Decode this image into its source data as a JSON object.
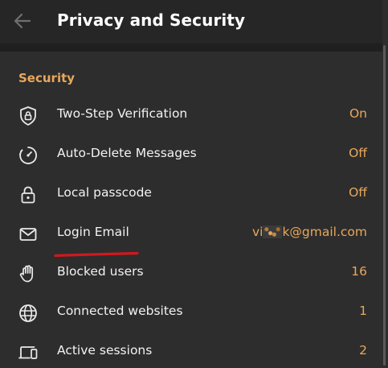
{
  "header": {
    "title": "Privacy and Security",
    "back_icon": "arrow-left-icon"
  },
  "colors": {
    "accent": "#e8a85b",
    "background": "#2d2d2d",
    "header_bg": "#262626",
    "text": "#f2f2f2",
    "annotation": "#d0191d"
  },
  "security": {
    "section_title": "Security",
    "items": [
      {
        "label": "Two-Step Verification",
        "value": "On",
        "icon": "shield-lock-icon"
      },
      {
        "label": "Auto-Delete Messages",
        "value": "Off",
        "icon": "timer-icon"
      },
      {
        "label": "Local passcode",
        "value": "Off",
        "icon": "padlock-icon"
      },
      {
        "label": "Login Email",
        "value_prefix": "vi",
        "value_suffix": "k@gmail.com",
        "icon": "envelope-icon"
      },
      {
        "label": "Blocked users",
        "value": "16",
        "icon": "hand-icon"
      },
      {
        "label": "Connected websites",
        "value": "1",
        "icon": "globe-icon"
      },
      {
        "label": "Active sessions",
        "value": "2",
        "icon": "devices-icon"
      }
    ]
  }
}
